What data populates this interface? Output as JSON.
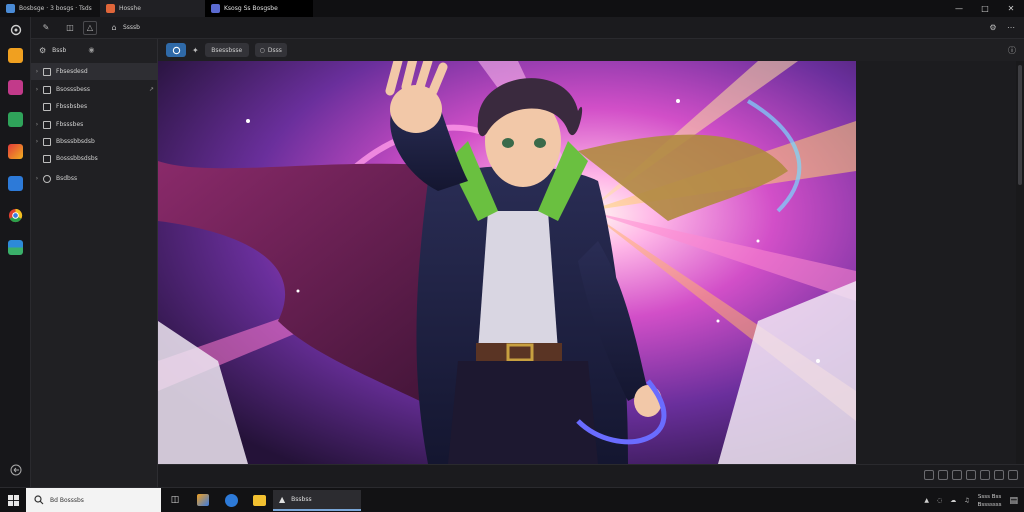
{
  "titlebar": {
    "tabs": [
      {
        "label": "Bosbsge · 3 bosgs · Tsds",
        "icon": "app-icon"
      },
      {
        "label": "Hosshe",
        "icon": "browser-icon"
      },
      {
        "label": "Ksosg Ss Bosgsbe",
        "icon": "shield-icon"
      }
    ],
    "controls": [
      "minimize-icon",
      "maximize-icon",
      "close-icon"
    ]
  },
  "toolbar1": {
    "items": [
      {
        "label": "",
        "icon": "pen-icon"
      },
      {
        "label": "",
        "icon": "folder-icon"
      },
      {
        "label": "",
        "icon": "image-icon"
      },
      {
        "label": "Ssssb",
        "icon": "home-icon"
      }
    ]
  },
  "sidebar": {
    "header_label": "Bssb",
    "items": [
      {
        "label": "Fbsesdesd",
        "expanded": false,
        "selected": true
      },
      {
        "label": "Bsosssbess",
        "expanded": false,
        "selected": false,
        "has_arrow": true
      },
      {
        "label": "Fbssbsbes",
        "expanded": false,
        "selected": false
      },
      {
        "label": "Fbsssbes",
        "expanded": false,
        "selected": false
      },
      {
        "label": "Bbsssbbsdsb",
        "expanded": false,
        "selected": false
      },
      {
        "label": "Bosssbbsdsbs",
        "expanded": false,
        "selected": false
      },
      {
        "label": "Bsdbss",
        "expanded": false,
        "selected": false
      }
    ]
  },
  "toolbar2": {
    "buttons": [
      "Bsessbsse",
      "Dsss"
    ]
  },
  "taskbar": {
    "search_placeholder": "Bd Bosssbs",
    "active_app_label": "Bssbss",
    "clock_time": "Ssss Bss",
    "clock_date": "Bsssssss"
  },
  "colors": {
    "accent": "#2f6aa8",
    "background": "#1c1c1e"
  }
}
